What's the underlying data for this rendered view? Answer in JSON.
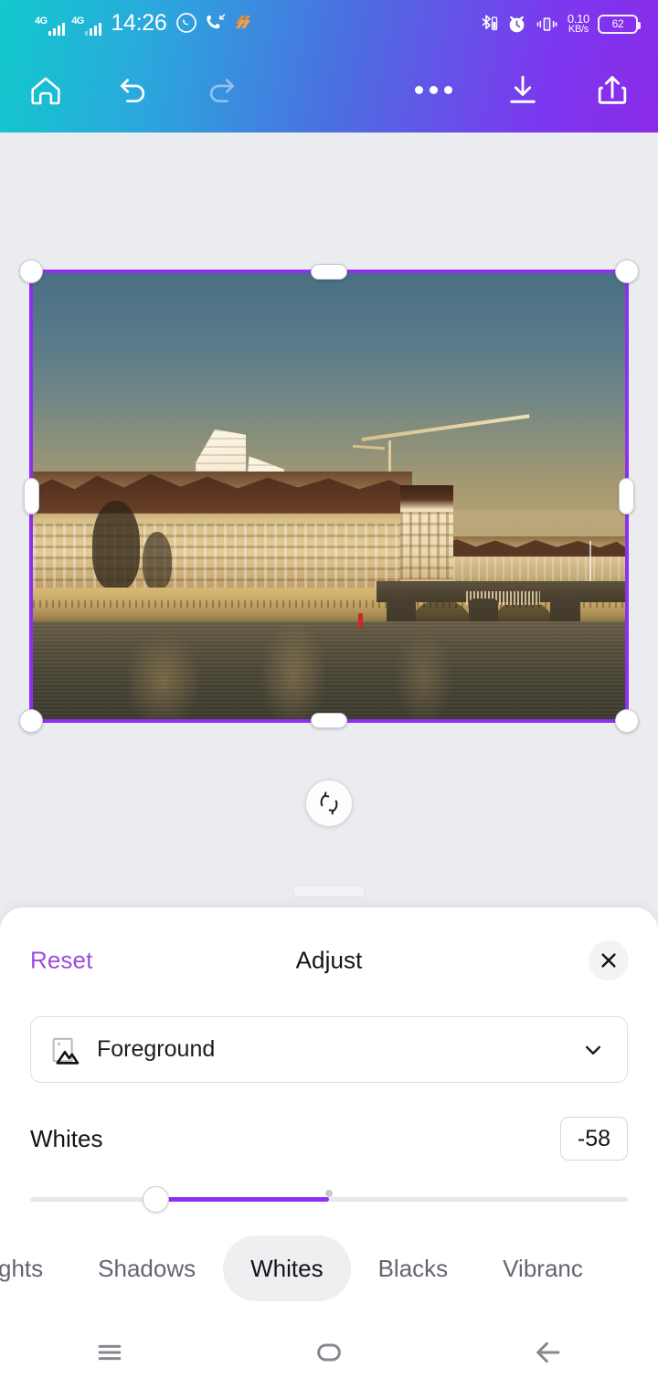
{
  "statusbar": {
    "sim1_network": "4G",
    "sim2_network": "4G",
    "time": "14:26",
    "icons": [
      "whatsapp-icon",
      "missed-call-icon",
      "orange-app-icon",
      "bluetooth-icon",
      "alarm-icon",
      "vibrate-icon"
    ],
    "net_speed_value": "0.10",
    "net_speed_unit": "KB/s",
    "battery_percent": "62"
  },
  "toolbar": {
    "home_label": "Home",
    "undo_label": "Undo",
    "redo_label": "Redo",
    "more_label": "More options",
    "download_label": "Download",
    "share_label": "Share",
    "gradient_start": "#12c9cc",
    "gradient_end": "#8a2be8"
  },
  "canvas": {
    "background": "#eaecef",
    "selection_border_color": "#8b31ef",
    "rotate_label": "Rotate",
    "image_description": "Riverside cityscape at golden hour with stone arch bridge, historic buildings, construction crane and two white towers"
  },
  "sheet": {
    "reset_label": "Reset",
    "title": "Adjust",
    "close_label": "Close",
    "layer": {
      "icon": "image-layer-icon",
      "label": "Foreground",
      "chevron": "chevron-down-icon"
    },
    "slider": {
      "name": "Whites",
      "value": "-58",
      "value_number": -58,
      "min": -100,
      "max": 100,
      "thumb_percent": 21,
      "accent_color": "#8b31ef"
    },
    "tabs": [
      {
        "label": "ghts",
        "full_label": "Highlights",
        "active": false,
        "clipped": true
      },
      {
        "label": "Shadows",
        "full_label": "Shadows",
        "active": false,
        "clipped": false
      },
      {
        "label": "Whites",
        "full_label": "Whites",
        "active": true,
        "clipped": false
      },
      {
        "label": "Blacks",
        "full_label": "Blacks",
        "active": false,
        "clipped": false
      },
      {
        "label": "Vibranc",
        "full_label": "Vibrance",
        "active": false,
        "clipped": true
      }
    ]
  },
  "navbar": {
    "recents_label": "Recents",
    "home_label": "Home",
    "back_label": "Back"
  }
}
